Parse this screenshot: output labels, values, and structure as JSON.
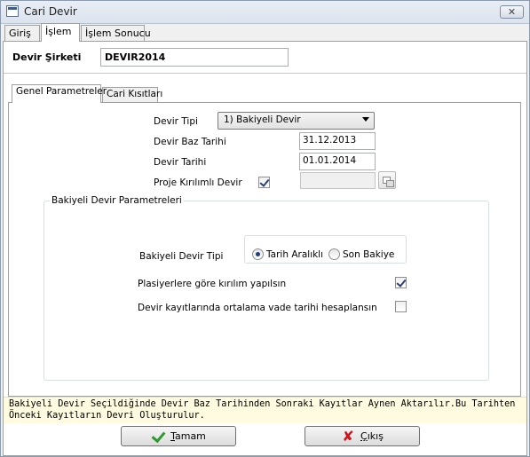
{
  "window": {
    "title": "Cari Devir",
    "close_glyph": "✕"
  },
  "top_tabs": [
    {
      "label": "Giriş",
      "active": false
    },
    {
      "label": "İşlem",
      "active": true
    },
    {
      "label": "İşlem Sonucu",
      "active": false
    }
  ],
  "company": {
    "label": "Devir Şirketi",
    "value": "DEVIR2014"
  },
  "inner_tabs": [
    {
      "label": "Genel Parametreler",
      "active": true
    },
    {
      "label": "Cari Kısıtları",
      "active": false
    }
  ],
  "form": {
    "devir_tipi": {
      "label": "Devir Tipi",
      "value": "1) Bakiyeli Devir"
    },
    "devir_baz_tarihi": {
      "label": "Devir Baz Tarihi",
      "value": "31.12.2013"
    },
    "devir_tarihi": {
      "label": "Devir Tarihi",
      "value": "01.01.2014"
    },
    "proje_kirilimli": {
      "label": "Proje Kırılımlı Devir",
      "checked": true,
      "value": ""
    }
  },
  "group": {
    "title": "Bakiyeli Devir Parametreleri",
    "bakiyeli_devir_tipi": {
      "label": "Bakiyeli Devir Tipi",
      "options": [
        {
          "label": "Tarih Aralıklı",
          "selected": true
        },
        {
          "label": "Son Bakiye",
          "selected": false
        }
      ]
    },
    "plasiyer": {
      "label": "Plasiyerlere göre kırılım yapılsın",
      "checked": true
    },
    "vade": {
      "label": "Devir kayıtlarında ortalama vade tarihi hesaplansın",
      "checked": false
    }
  },
  "info": {
    "line1": "Bakiyeli Devir Seçildiğinde Devir Baz Tarihinden Sonraki Kayıtlar Aynen Aktarılır.Bu Tarihten",
    "line2": "Önceki Kayıtların Devri Oluşturulur."
  },
  "buttons": {
    "ok": {
      "mnemonic": "T",
      "rest": "amam",
      "icon": "checkmark-icon"
    },
    "cancel": {
      "mnemonic": "Ç",
      "rest": "ıkış",
      "icon": "x-icon"
    }
  },
  "colors": {
    "info_bg": "#fffbe0",
    "ok_icon": "#2e9a2e",
    "cancel_icon": "#d0141c"
  }
}
